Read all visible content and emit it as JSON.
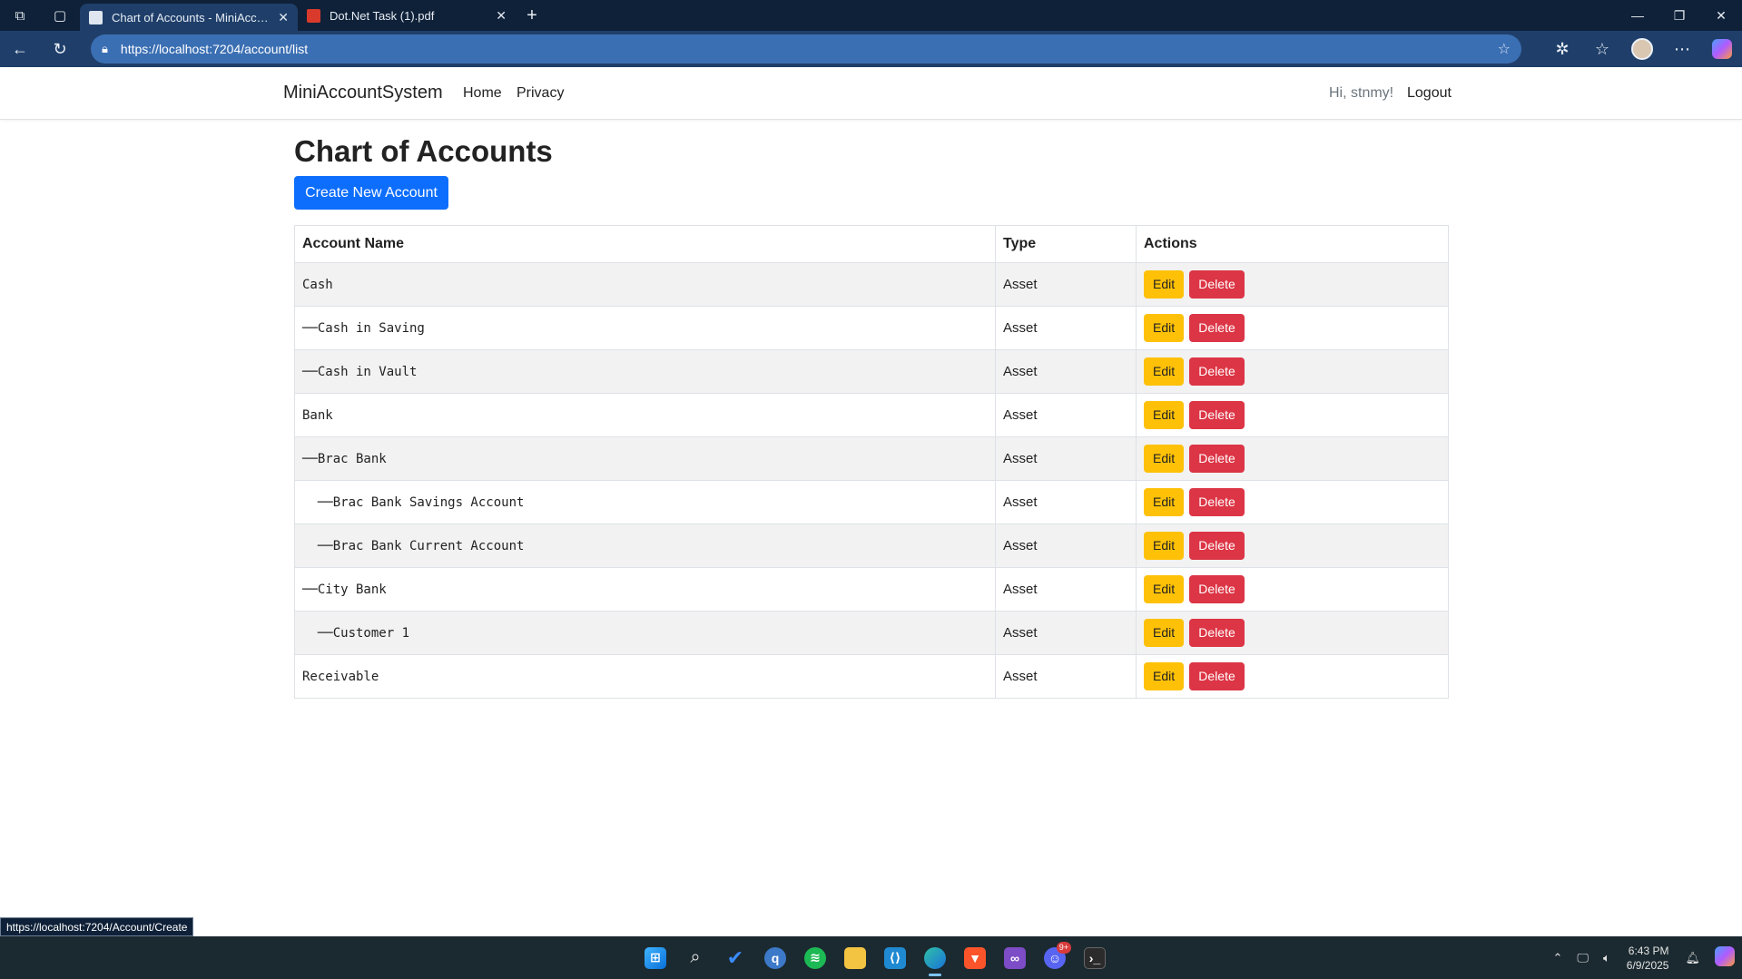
{
  "browser": {
    "tabs": [
      {
        "title": "Chart of Accounts - MiniAccount!",
        "active": true,
        "icon": "page-icon"
      },
      {
        "title": "Dot.Net Task (1).pdf",
        "active": false,
        "icon": "pdf-icon"
      }
    ],
    "url": "https://localhost:7204/account/list",
    "status_link": "https://localhost:7204/Account/Create"
  },
  "navbar": {
    "brand": "MiniAccountSystem",
    "links": [
      "Home",
      "Privacy"
    ],
    "greeting": "Hi, stnmy!",
    "logout": "Logout"
  },
  "main": {
    "title": "Chart of Accounts",
    "create_button": "Create New Account",
    "table": {
      "headers": [
        "Account Name",
        "Type",
        "Actions"
      ],
      "edit_label": "Edit",
      "delete_label": "Delete",
      "rows": [
        {
          "name": "Cash",
          "type": "Asset"
        },
        {
          "name": "──Cash in Saving",
          "type": "Asset"
        },
        {
          "name": "──Cash in Vault",
          "type": "Asset"
        },
        {
          "name": "Bank",
          "type": "Asset"
        },
        {
          "name": "──Brac Bank",
          "type": "Asset"
        },
        {
          "name": "  ──Brac Bank Savings Account",
          "type": "Asset"
        },
        {
          "name": "  ──Brac Bank Current Account",
          "type": "Asset"
        },
        {
          "name": "──City Bank",
          "type": "Asset"
        },
        {
          "name": "  ──Customer 1",
          "type": "Asset"
        },
        {
          "name": "Receivable",
          "type": "Asset"
        }
      ]
    }
  },
  "taskbar": {
    "time": "6:43 PM",
    "date": "6/9/2025",
    "badge": "9+"
  },
  "colors": {
    "primary": "#0d6efd",
    "warning": "#ffc107",
    "danger": "#dc3545"
  }
}
